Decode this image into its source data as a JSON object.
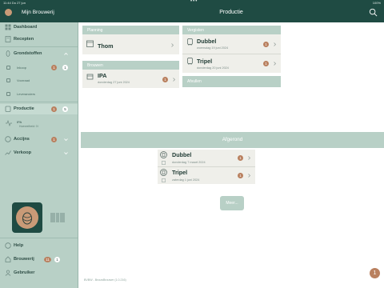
{
  "status_bar": {
    "time": "11:44",
    "date": "Do 27 jun",
    "dots": "•••",
    "battery": "100%"
  },
  "app": {
    "name": "Mijn Brouwerij"
  },
  "header": {
    "title": "Productie"
  },
  "sidebar": {
    "dashboard": "Dashboard",
    "recepten": "Recepten",
    "grondstoffen": "Grondstoffen",
    "grondstoffen_sub": [
      {
        "label": "Inkoop",
        "badge_a": "1",
        "badge_b": "1"
      },
      {
        "label": "Voorraad"
      },
      {
        "label": "Leveranciers"
      }
    ],
    "productie": {
      "label": "Productie",
      "badge_a": "1",
      "badge_b": "5"
    },
    "productie_sub": {
      "label": "IPA",
      "detail": "Hoeveelheid: 0 l"
    },
    "accijns": {
      "label": "Accijns",
      "badge": "1"
    },
    "verkoop": "Verkoop",
    "help": "Help",
    "brouwerij": {
      "label": "Brouwerij",
      "badge_a": "11",
      "badge_b": "1"
    },
    "gebruiker": "Gebruiker"
  },
  "planning": {
    "header": "Planning",
    "items": [
      {
        "title": "Thom",
        "badge": ""
      }
    ]
  },
  "brouwen": {
    "header": "Brouwen",
    "items": [
      {
        "title": "IPA",
        "date": "donderdag 27 juni 2024",
        "badge": "1"
      }
    ]
  },
  "vergisten": {
    "header": "Vergisten",
    "items": [
      {
        "title": "Dubbel",
        "date": "woensdag 19 juni 2024",
        "badge": "1"
      },
      {
        "title": "Tripel",
        "date": "donderdag 20 juni 2024",
        "badge": "1"
      }
    ]
  },
  "afvullen": {
    "header": "Afvullen"
  },
  "afgerond": {
    "header": "Afgerond",
    "items": [
      {
        "title": "Dubbel",
        "date": "donderdag 7 maart 2024",
        "badge": "1"
      },
      {
        "title": "Tripel",
        "date": "zaterdag 1 juni 2024",
        "badge": "1"
      }
    ]
  },
  "more_label": "Meer...",
  "footer": "BVBW - BrouwBrouwer (1.0.216)",
  "fab_badge": "1",
  "colors": {
    "header": "#1f4b43",
    "sidebar": "#b8d0c6",
    "accent": "#b9805f",
    "card": "#efefea"
  },
  "icons": [
    "search-icon",
    "dashboard-icon",
    "book-icon",
    "grain-icon",
    "factory-icon",
    "beer-icon",
    "cart-icon",
    "help-icon",
    "house-icon",
    "user-icon",
    "barcode-icon",
    "calendar-icon",
    "kettle-icon",
    "fermenter-icon",
    "bottle-icon",
    "chevron-right-icon",
    "chevron-down-icon"
  ]
}
